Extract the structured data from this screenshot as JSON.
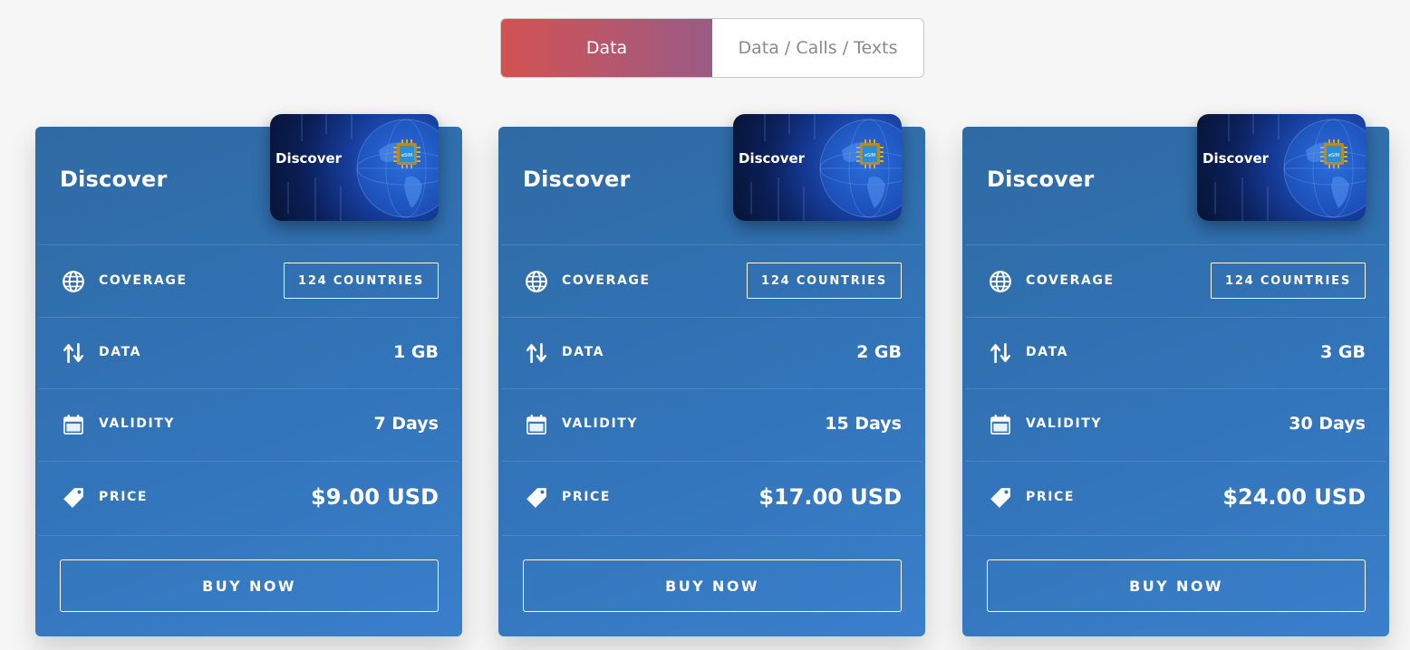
{
  "tabs": [
    {
      "label": "Data",
      "active": true
    },
    {
      "label": "Data / Calls / Texts",
      "active": false
    }
  ],
  "labels": {
    "coverage": "COVERAGE",
    "data": "DATA",
    "validity": "VALIDITY",
    "price": "PRICE",
    "buy": "BUY NOW"
  },
  "icons": {
    "coverage": "globe-icon",
    "data": "up-down-arrows-icon",
    "validity": "calendar-icon",
    "price": "price-tag-icon"
  },
  "colors": {
    "active_tab_start": "#d35252",
    "active_tab_end": "#9b5b86",
    "card_bg": "#3274b9"
  },
  "plans": [
    {
      "title": "Discover",
      "sim_label": "Discover",
      "coverage": "124 COUNTRIES",
      "data": "1 GB",
      "validity": "7 Days",
      "price": "$9.00 USD"
    },
    {
      "title": "Discover",
      "sim_label": "Discover",
      "coverage": "124 COUNTRIES",
      "data": "2 GB",
      "validity": "15 Days",
      "price": "$17.00 USD"
    },
    {
      "title": "Discover",
      "sim_label": "Discover",
      "coverage": "124 COUNTRIES",
      "data": "3 GB",
      "validity": "30 Days",
      "price": "$24.00 USD"
    }
  ]
}
